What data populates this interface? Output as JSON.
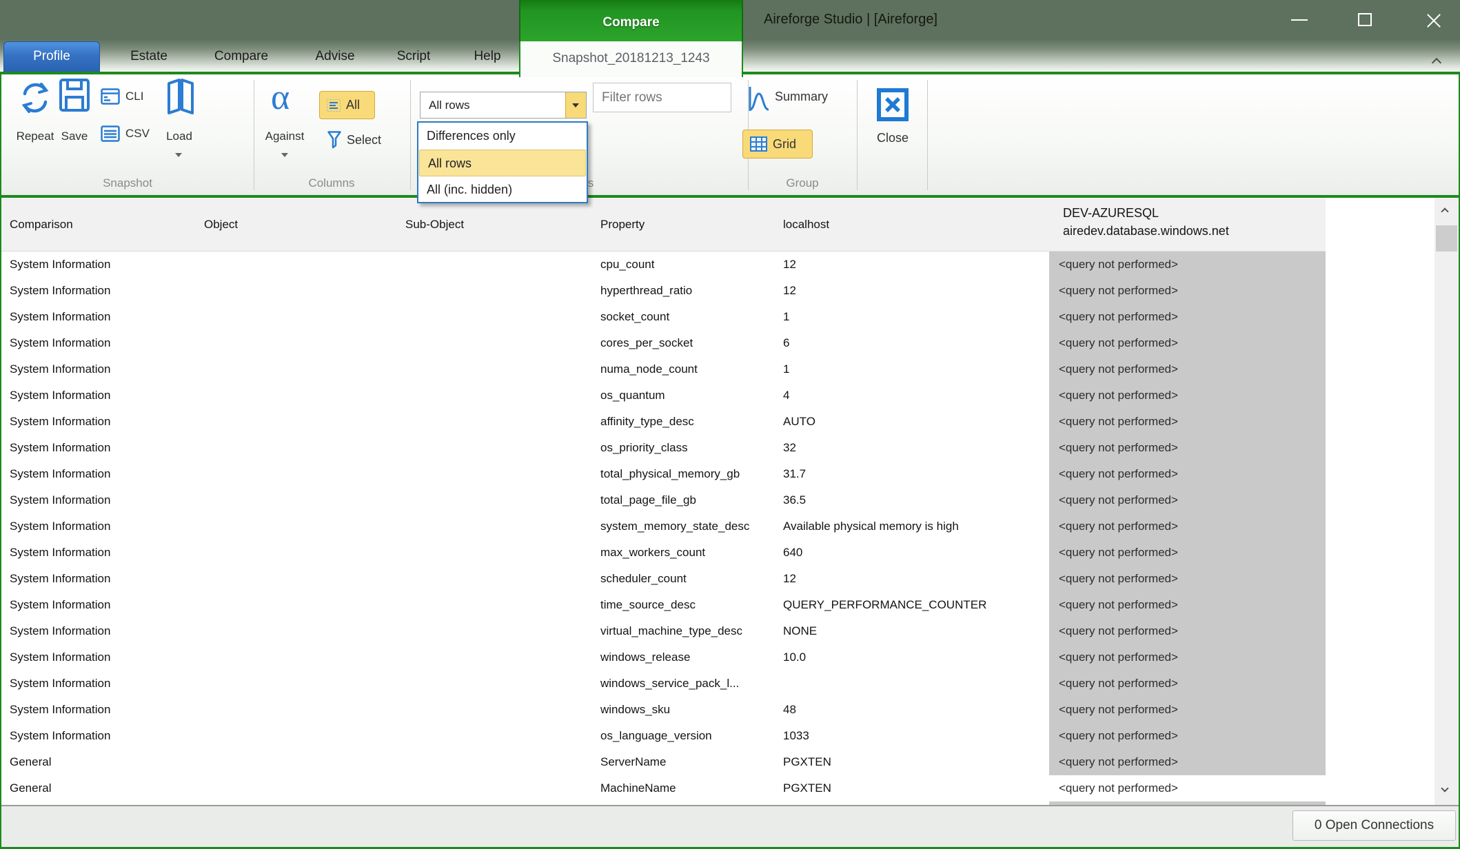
{
  "window": {
    "title": "Aireforge Studio |  [Aireforge]",
    "controls": {
      "minimize": "minimize",
      "maximize": "maximize",
      "close": "close"
    }
  },
  "contextual_tab": {
    "header": "Compare",
    "document_tab": "Snapshot_20181213_1243"
  },
  "tabs": [
    {
      "label": "Profile",
      "selected": true
    },
    {
      "label": "Estate"
    },
    {
      "label": "Compare"
    },
    {
      "label": "Advise"
    },
    {
      "label": "Script"
    },
    {
      "label": "Help"
    }
  ],
  "ribbon": {
    "snapshot_group": {
      "label": "Snapshot",
      "repeat_label": "Repeat",
      "save_label": "Save",
      "cli_label": "CLI",
      "csv_label": "CSV",
      "load_label": "Load"
    },
    "columns_group": {
      "label": "Columns",
      "against_label": "Against",
      "all_label": "All",
      "select_label": "Select"
    },
    "rows_group": {
      "label": "Rows",
      "combo_value": "All rows",
      "combo_options": [
        "Differences only",
        "All rows",
        "All (inc. hidden)"
      ],
      "combo_selected_index": 1,
      "filter_placeholder": "Filter rows"
    },
    "group_group": {
      "label": "Group",
      "summary_label": "Summary",
      "grid_label": "Grid"
    },
    "close_label": "Close"
  },
  "grid": {
    "columns": [
      "Comparison",
      "Object",
      "Sub-Object",
      "Property",
      "localhost"
    ],
    "remote_column": {
      "line1": "DEV-AZURESQL",
      "line2": "airedev.database.windows.net"
    },
    "not_performed_text": "<query not performed>",
    "rows": [
      {
        "comparison": "System Information",
        "object": "",
        "sub_object": "",
        "property": "cpu_count",
        "localhost": "12",
        "remote": "<query not performed>",
        "remote_shaded": true
      },
      {
        "comparison": "System Information",
        "object": "",
        "sub_object": "",
        "property": "hyperthread_ratio",
        "localhost": "12",
        "remote": "<query not performed>",
        "remote_shaded": true
      },
      {
        "comparison": "System Information",
        "object": "",
        "sub_object": "",
        "property": "socket_count",
        "localhost": "1",
        "remote": "<query not performed>",
        "remote_shaded": true
      },
      {
        "comparison": "System Information",
        "object": "",
        "sub_object": "",
        "property": "cores_per_socket",
        "localhost": "6",
        "remote": "<query not performed>",
        "remote_shaded": true
      },
      {
        "comparison": "System Information",
        "object": "",
        "sub_object": "",
        "property": "numa_node_count",
        "localhost": "1",
        "remote": "<query not performed>",
        "remote_shaded": true
      },
      {
        "comparison": "System Information",
        "object": "",
        "sub_object": "",
        "property": "os_quantum",
        "localhost": "4",
        "remote": "<query not performed>",
        "remote_shaded": true
      },
      {
        "comparison": "System Information",
        "object": "",
        "sub_object": "",
        "property": "affinity_type_desc",
        "localhost": "AUTO",
        "remote": "<query not performed>",
        "remote_shaded": true
      },
      {
        "comparison": "System Information",
        "object": "",
        "sub_object": "",
        "property": "os_priority_class",
        "localhost": "32",
        "remote": "<query not performed>",
        "remote_shaded": true
      },
      {
        "comparison": "System Information",
        "object": "",
        "sub_object": "",
        "property": "total_physical_memory_gb",
        "localhost": "31.7",
        "remote": "<query not performed>",
        "remote_shaded": true
      },
      {
        "comparison": "System Information",
        "object": "",
        "sub_object": "",
        "property": "total_page_file_gb",
        "localhost": "36.5",
        "remote": "<query not performed>",
        "remote_shaded": true
      },
      {
        "comparison": "System Information",
        "object": "",
        "sub_object": "",
        "property": "system_memory_state_desc",
        "localhost": "Available physical memory is high",
        "remote": "<query not performed>",
        "remote_shaded": true
      },
      {
        "comparison": "System Information",
        "object": "",
        "sub_object": "",
        "property": "max_workers_count",
        "localhost": "640",
        "remote": "<query not performed>",
        "remote_shaded": true
      },
      {
        "comparison": "System Information",
        "object": "",
        "sub_object": "",
        "property": "scheduler_count",
        "localhost": "12",
        "remote": "<query not performed>",
        "remote_shaded": true
      },
      {
        "comparison": "System Information",
        "object": "",
        "sub_object": "",
        "property": "time_source_desc",
        "localhost": "QUERY_PERFORMANCE_COUNTER",
        "remote": "<query not performed>",
        "remote_shaded": true
      },
      {
        "comparison": "System Information",
        "object": "",
        "sub_object": "",
        "property": "virtual_machine_type_desc",
        "localhost": "NONE",
        "remote": "<query not performed>",
        "remote_shaded": true
      },
      {
        "comparison": "System Information",
        "object": "",
        "sub_object": "",
        "property": "windows_release",
        "localhost": "10.0",
        "remote": "<query not performed>",
        "remote_shaded": true
      },
      {
        "comparison": "System Information",
        "object": "",
        "sub_object": "",
        "property": "windows_service_pack_l...",
        "localhost": "",
        "remote": "<query not performed>",
        "remote_shaded": true
      },
      {
        "comparison": "System Information",
        "object": "",
        "sub_object": "",
        "property": "windows_sku",
        "localhost": "48",
        "remote": "<query not performed>",
        "remote_shaded": true
      },
      {
        "comparison": "System Information",
        "object": "",
        "sub_object": "",
        "property": "os_language_version",
        "localhost": "1033",
        "remote": "<query not performed>",
        "remote_shaded": true
      },
      {
        "comparison": "General",
        "object": "",
        "sub_object": "",
        "property": "ServerName",
        "localhost": "PGXTEN",
        "remote": "<query not performed>",
        "remote_shaded": true
      },
      {
        "comparison": "General",
        "object": "",
        "sub_object": "",
        "property": "MachineName",
        "localhost": "PGXTEN",
        "remote": "<query not performed>",
        "remote_shaded": false
      }
    ]
  },
  "status_bar": {
    "connections_label": "0 Open Connections"
  },
  "colors": {
    "accent_green": "#1c8a1c",
    "title_bar": "#5e715e",
    "icon_blue": "#2b7cd3",
    "toggle_yellow": "#f8da79",
    "selection_yellow": "#f9e498",
    "gray_cell": "#c9c9c9"
  }
}
